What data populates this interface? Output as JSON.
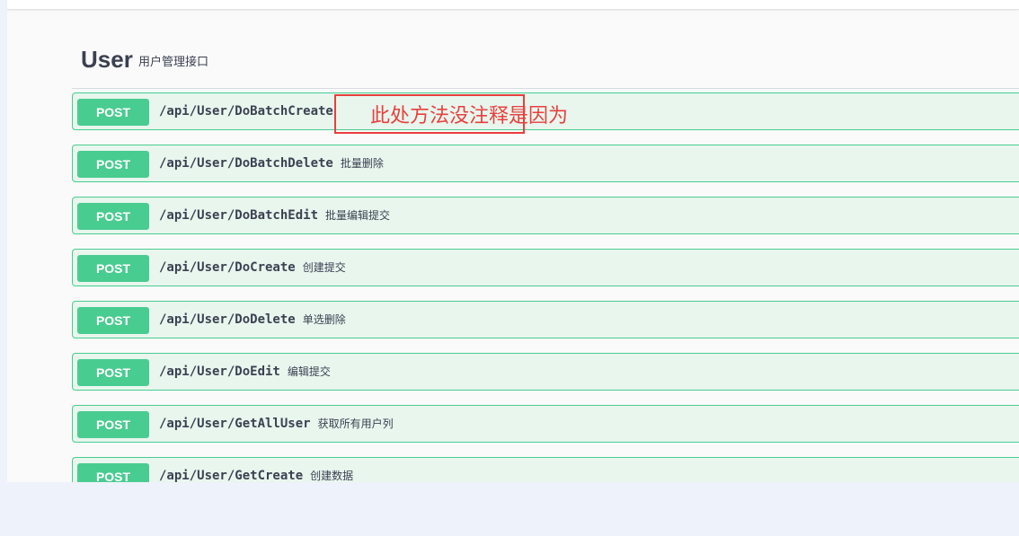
{
  "section": {
    "title": "User",
    "description": "用户管理接口"
  },
  "operations": [
    {
      "method": "POST",
      "path": "/api/User/DoBatchCreate",
      "summary": ""
    },
    {
      "method": "POST",
      "path": "/api/User/DoBatchDelete",
      "summary": "批量删除"
    },
    {
      "method": "POST",
      "path": "/api/User/DoBatchEdit",
      "summary": "批量编辑提交"
    },
    {
      "method": "POST",
      "path": "/api/User/DoCreate",
      "summary": "创建提交"
    },
    {
      "method": "POST",
      "path": "/api/User/DoDelete",
      "summary": "单选删除"
    },
    {
      "method": "POST",
      "path": "/api/User/DoEdit",
      "summary": "编辑提交"
    },
    {
      "method": "POST",
      "path": "/api/User/GetAllUser",
      "summary": "获取所有用户列"
    },
    {
      "method": "POST",
      "path": "/api/User/GetCreate",
      "summary": "创建数据"
    }
  ],
  "annotation": {
    "text": "此处方法没注释是因为"
  },
  "colors": {
    "post_accent": "#49cc90",
    "post_background": "#e8f6ee",
    "annotation": "#e8403d"
  }
}
